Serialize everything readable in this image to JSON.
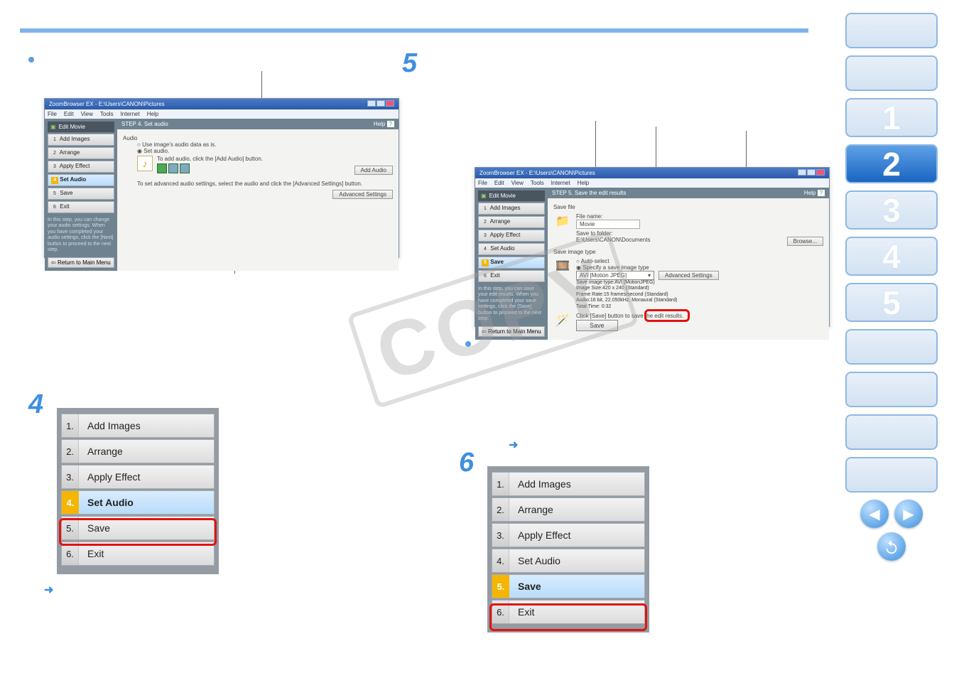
{
  "watermark": "COPY",
  "nav": {
    "labels": [
      "1",
      "2",
      "3",
      "4",
      "5"
    ]
  },
  "win1": {
    "title": "ZoomBrowser EX - E:\\Users\\CANON\\Pictures",
    "menus": [
      "File",
      "Edit",
      "View",
      "Tools",
      "Internet",
      "Help"
    ],
    "side_header": "Edit Movie",
    "steps": [
      {
        "n": "1",
        "label": "Add Images"
      },
      {
        "n": "2",
        "label": "Arrange"
      },
      {
        "n": "3",
        "label": "Apply Effect"
      },
      {
        "n": "4",
        "label": "Set Audio"
      },
      {
        "n": "5",
        "label": "Save"
      },
      {
        "n": "6",
        "label": "Exit"
      }
    ],
    "side_text": "In this step, you can change your audio settings. When you have completed your audio settings, click the [Next] button to proceed to the next step.",
    "return": "Return to Main Menu",
    "stepbar": "STEP 4. Set audio",
    "help": "Help",
    "radio1": "Use image's audio data as is.",
    "radio2": "Set audio.",
    "note": "To add audio, click the [Add Audio] button.",
    "btn_add": "Add Audio",
    "note2": "To set advanced audio settings, select the audio and click the [Advanced Settings] button.",
    "btn_adv": "Advanced Settings",
    "audio_hdr": "Audio"
  },
  "win2": {
    "title": "ZoomBrowser EX - E:\\Users\\CANON\\Pictures",
    "menus": [
      "File",
      "Edit",
      "View",
      "Tools",
      "Internet",
      "Help"
    ],
    "side_header": "Edit Movie",
    "steps": [
      {
        "n": "1",
        "label": "Add Images"
      },
      {
        "n": "2",
        "label": "Arrange"
      },
      {
        "n": "3",
        "label": "Apply Effect"
      },
      {
        "n": "4",
        "label": "Set Audio"
      },
      {
        "n": "5",
        "label": "Save"
      },
      {
        "n": "6",
        "label": "Exit"
      }
    ],
    "side_text": "In this step, you can save your edit results. When you have completed your save settings, click the [Save] button to proceed to the next step.",
    "return": "Return to Main Menu",
    "stepbar": "STEP 5. Save the edit results",
    "help": "Help",
    "section_file": "Save file",
    "filename_lbl": "File name:",
    "filename_val": "Movie",
    "saveto_lbl": "Save to folder:",
    "saveto_val": "E:\\Users\\CANON\\Documents",
    "browse": "Browse...",
    "section_type": "Save image type",
    "auto": "Auto-select",
    "spec": "Specify a save image type",
    "dropdown": "AVI [Motion JPEG]",
    "adv": "Advanced Settings",
    "info1": "Save image type:AVI (MotionJPEG)",
    "info2": "Image Size:420 x 240 (Standard)",
    "info3": "Frame Rate:15 frames/second (Standard)",
    "info4": "Audio:16 bit, 22.050kHz, Monaural (Standard)",
    "info5": "Total Time: 0:32",
    "click_save": "Click [Save] button to save the edit results.",
    "save": "Save"
  },
  "menu4": {
    "items": [
      {
        "n": "1.",
        "label": "Add Images"
      },
      {
        "n": "2.",
        "label": "Arrange"
      },
      {
        "n": "3.",
        "label": "Apply Effect"
      },
      {
        "n": "4.",
        "label": "Set Audio"
      },
      {
        "n": "5.",
        "label": "Save"
      },
      {
        "n": "6.",
        "label": "Exit"
      }
    ]
  },
  "menu6": {
    "items": [
      {
        "n": "1.",
        "label": "Add Images"
      },
      {
        "n": "2.",
        "label": "Arrange"
      },
      {
        "n": "3.",
        "label": "Apply Effect"
      },
      {
        "n": "4.",
        "label": "Set Audio"
      },
      {
        "n": "5.",
        "label": "Save"
      },
      {
        "n": "6.",
        "label": "Exit"
      }
    ]
  }
}
